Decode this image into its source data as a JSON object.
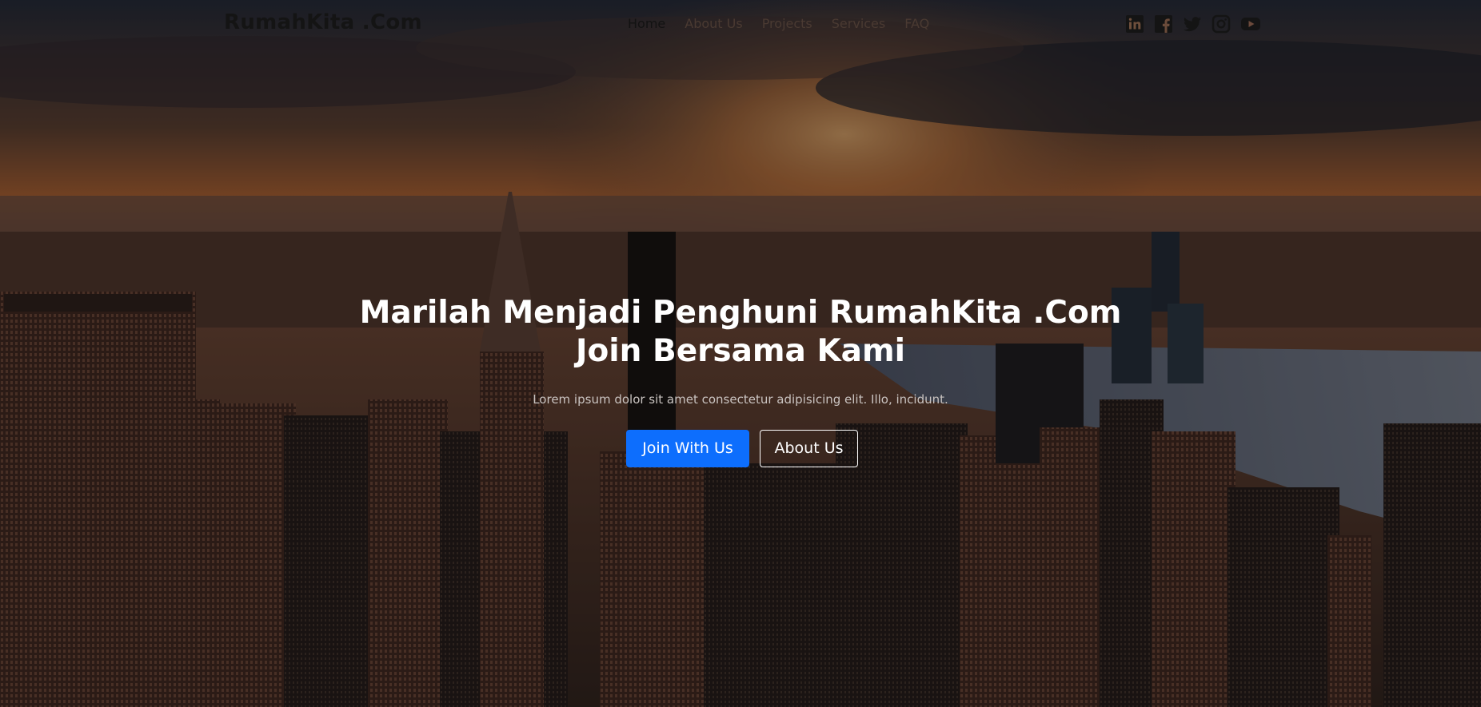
{
  "brand": {
    "name": "RumahKita .Com"
  },
  "nav": {
    "items": [
      {
        "label": "Home",
        "active": true
      },
      {
        "label": "About Us",
        "active": false
      },
      {
        "label": "Projects",
        "active": false
      },
      {
        "label": "Services",
        "active": false
      },
      {
        "label": "FAQ",
        "active": false
      }
    ]
  },
  "socials": [
    {
      "icon": "linkedin-icon"
    },
    {
      "icon": "facebook-icon"
    },
    {
      "icon": "twitter-icon"
    },
    {
      "icon": "instagram-icon"
    },
    {
      "icon": "youtube-icon"
    }
  ],
  "hero": {
    "title_line1": "Marilah Menjadi Penghuni RumahKita .Com",
    "title_line2": "Join Bersama Kami",
    "subtitle": "Lorem ipsum dolor sit amet consectetur adipisicing elit. Illo, incidunt.",
    "primary_button": "Join With Us",
    "secondary_button": "About Us"
  },
  "colors": {
    "primary": "#0d6efd",
    "brand_text": "#141414",
    "hero_text": "#ffffff"
  }
}
